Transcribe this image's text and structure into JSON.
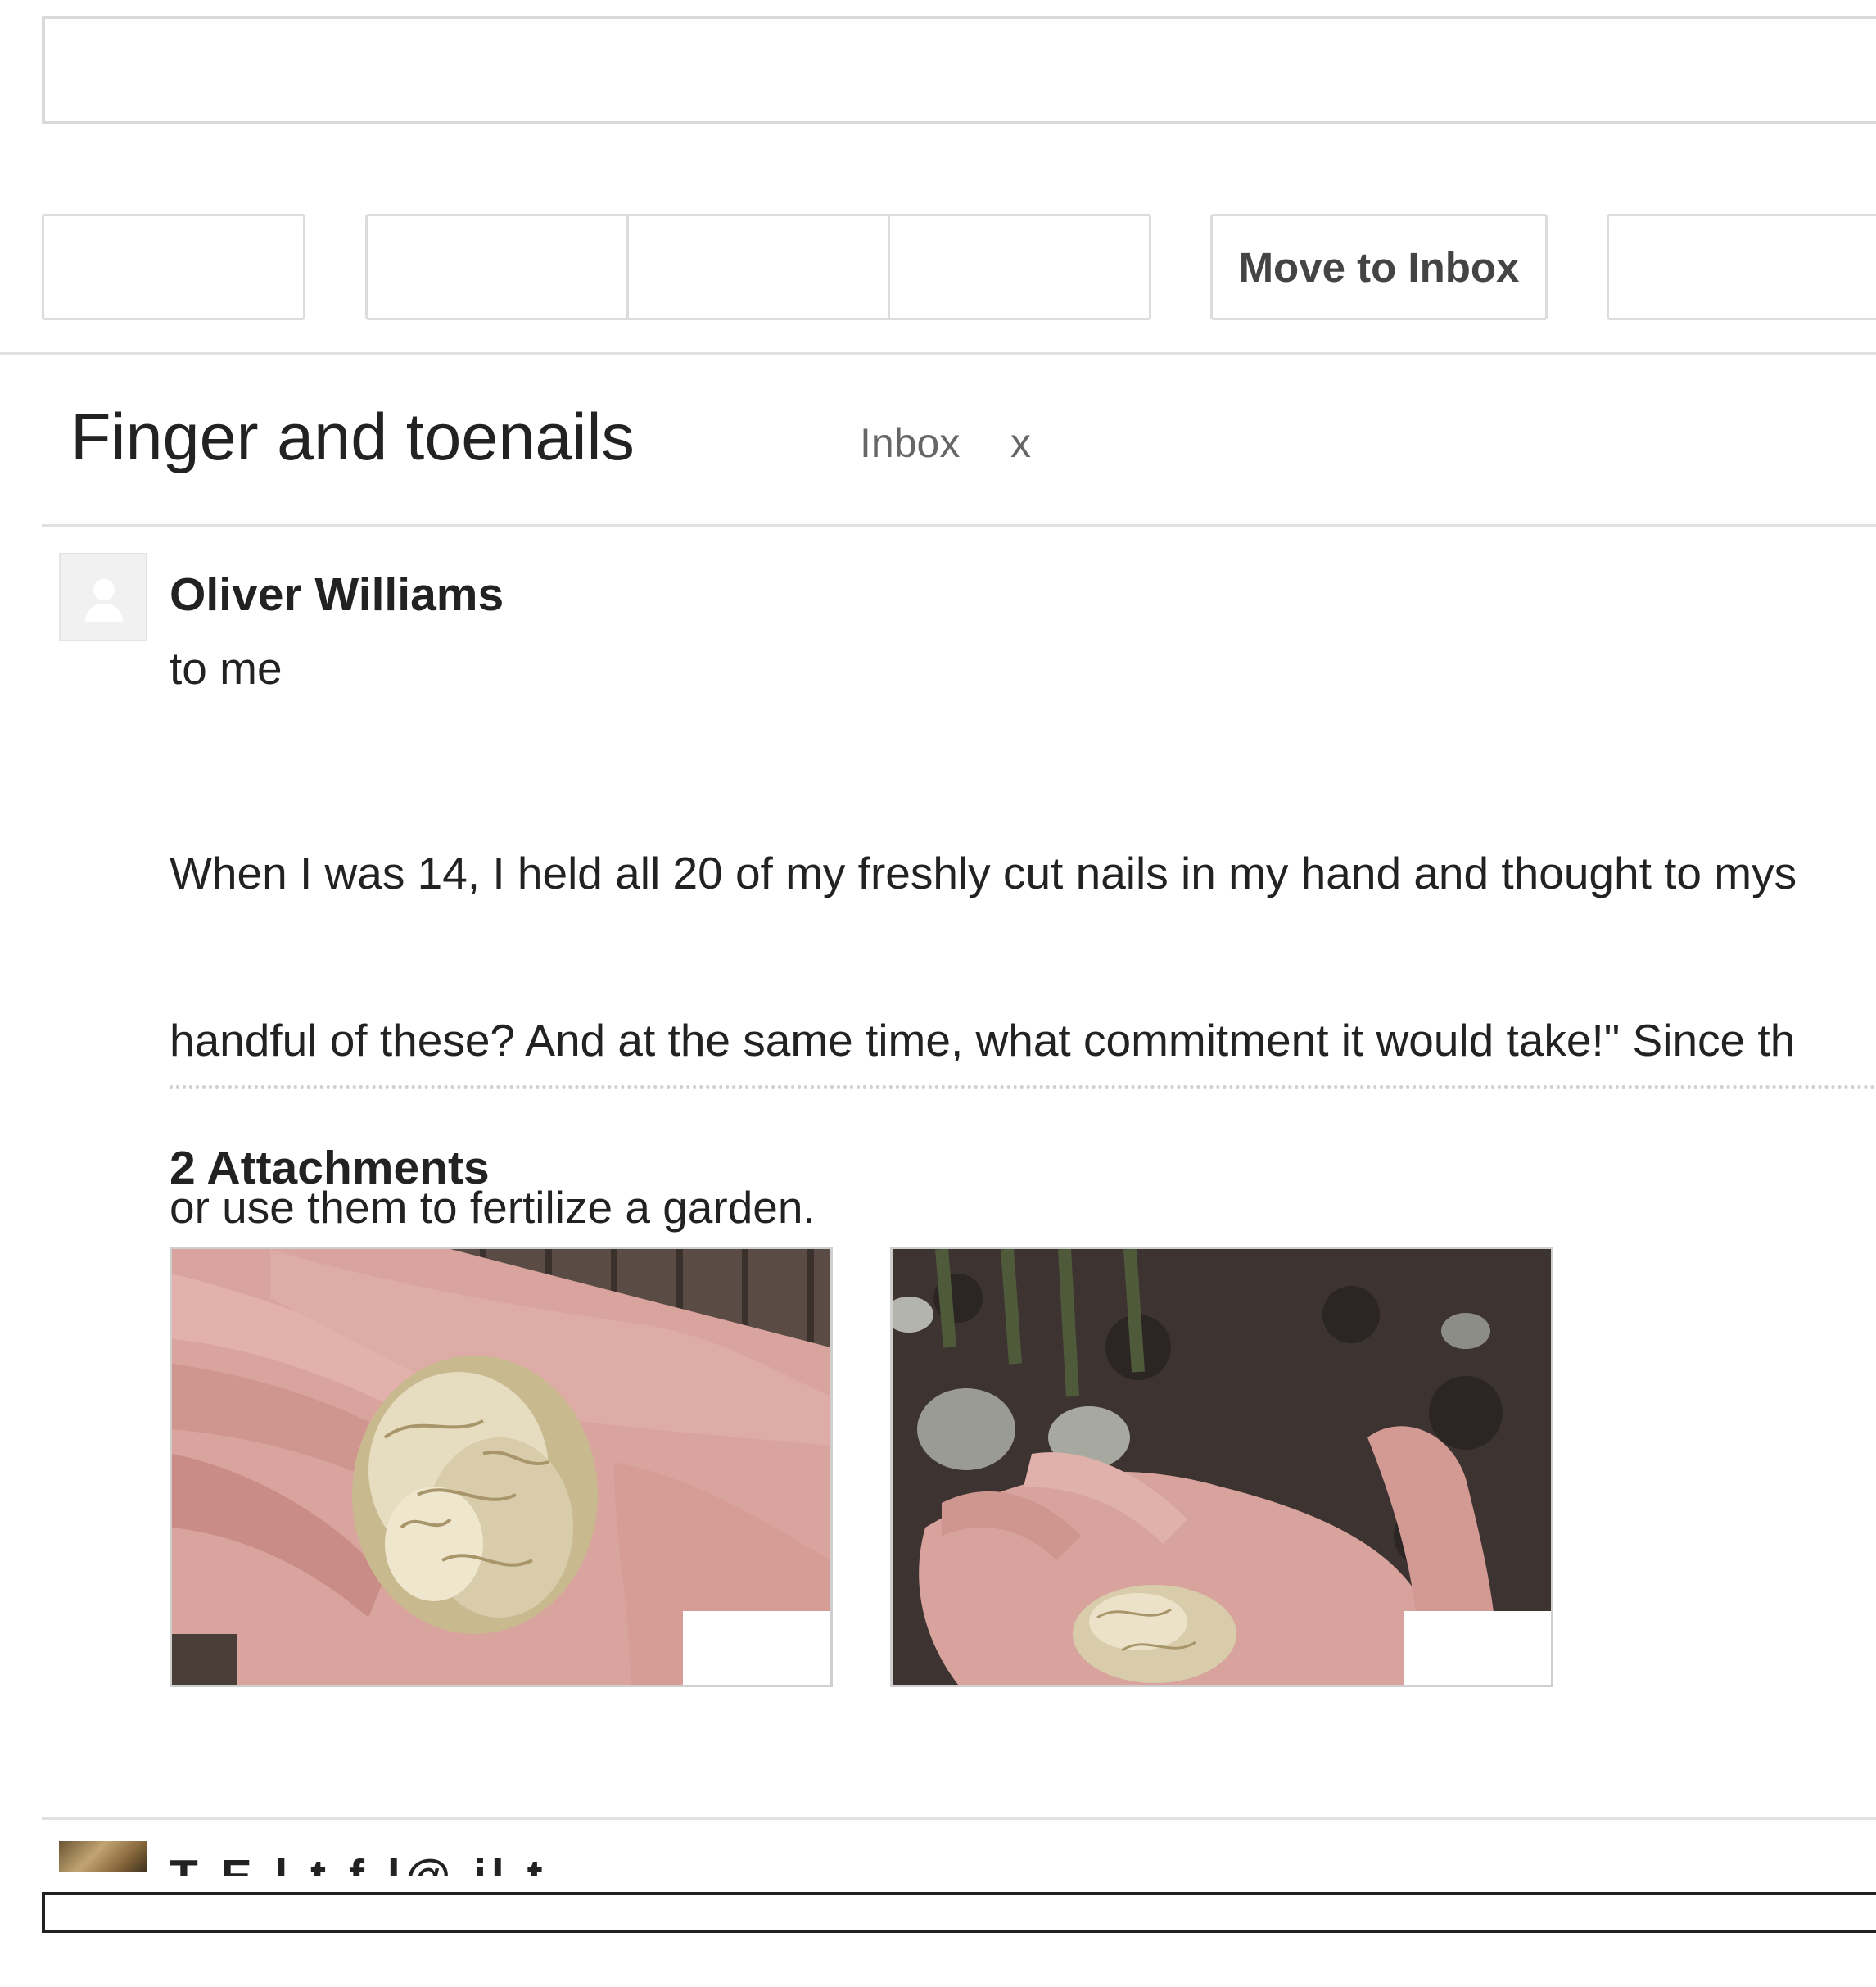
{
  "toolbar": {
    "move_to_inbox_label": "Move to Inbox"
  },
  "thread": {
    "subject": "Finger and toenails",
    "label": "Inbox",
    "label_remove": "x"
  },
  "message": {
    "sender": "Oliver Williams",
    "recipient": "to me",
    "body_lines": [
      "When I was 14, I held all 20 of my freshly cut nails in my hand and thought to mys",
      "handful of these? And at the same time, what commitment it would take!\" Since th",
      "or use them to fertilize a garden."
    ],
    "attachments_title": "2 Attachments",
    "attachments": [
      {
        "kind": "image",
        "depicts": "hand holding nail clippings on wooden deck"
      },
      {
        "kind": "image",
        "depicts": "hand holding nail clippings over garden soil"
      }
    ]
  },
  "next_message": {
    "sender_partial": "T  E  l  t  f  l@  il  t"
  },
  "icons": {
    "avatar": "default-person-icon",
    "remove_label": "close-icon"
  },
  "colors": {
    "border": "#dcdcdc",
    "text": "#222222",
    "muted_text": "#666666"
  }
}
